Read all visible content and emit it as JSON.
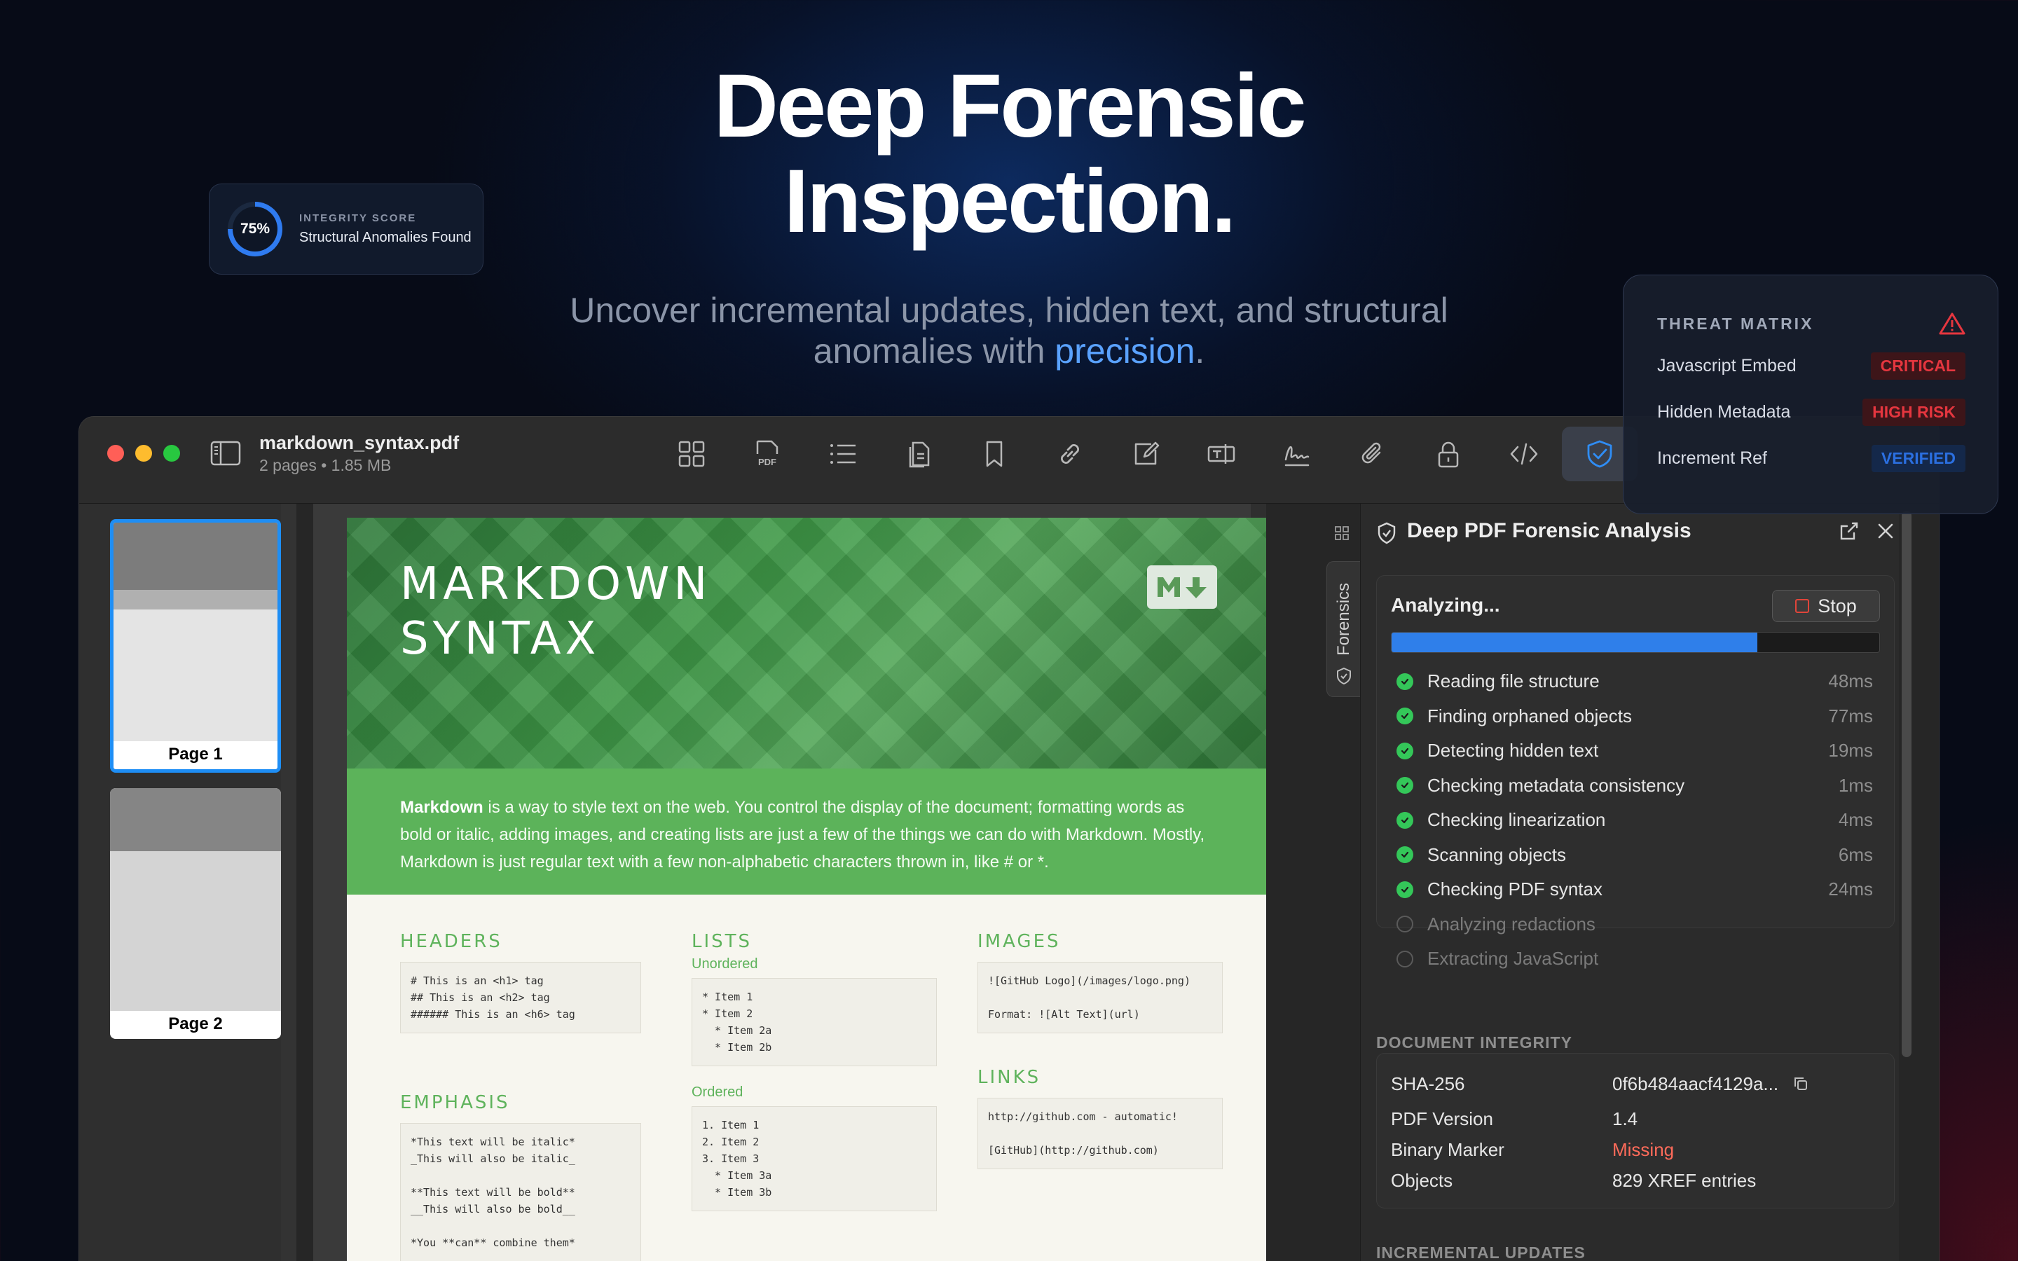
{
  "hero": {
    "title_line1": "Deep Forensic",
    "title_line2": "Inspection.",
    "subtitle_part1": "Uncover incremental updates, hidden text, and structural",
    "subtitle_part2": "anomalies with ",
    "subtitle_accent": "precision",
    "subtitle_end": "."
  },
  "integrity_card": {
    "score": "75%",
    "score_fraction": 0.75,
    "label": "INTEGRITY SCORE",
    "title": "Structural Anomalies Found"
  },
  "threat_matrix": {
    "title": "THREAT MATRIX",
    "rows": [
      {
        "name": "Javascript Embed",
        "badge": "CRITICAL"
      },
      {
        "name": "Hidden Metadata",
        "badge": "HIGH RISK"
      },
      {
        "name": "Increment Ref",
        "badge": "VERIFIED"
      }
    ]
  },
  "window": {
    "file_name": "markdown_syntax.pdf",
    "file_meta": "2 pages • 1.85 MB",
    "toolbar": [
      {
        "icon": "grid-icon"
      },
      {
        "icon": "pdf-icon",
        "text": "PDF"
      },
      {
        "icon": "list-icon"
      },
      {
        "icon": "pages-icon"
      },
      {
        "icon": "bookmark-icon"
      },
      {
        "icon": "link-icon"
      },
      {
        "icon": "edit-icon"
      },
      {
        "icon": "text-field-icon"
      },
      {
        "icon": "signature-icon"
      },
      {
        "icon": "paperclip-icon"
      },
      {
        "icon": "lock-icon"
      },
      {
        "icon": "code-icon"
      },
      {
        "icon": "shield-check-icon"
      }
    ]
  },
  "thumbnails": [
    {
      "label": "Page 1"
    },
    {
      "label": "Page 2"
    }
  ],
  "document": {
    "banner_line1": "MARKDOWN",
    "banner_line2": "SYNTAX",
    "intro_bold": "Markdown",
    "intro_rest": " is a way to style text on the web. You control the display of the document; formatting words as bold or italic, adding images, and creating lists are just a few of the things we can do with Markdown. Mostly, Markdown is just regular text with a few non-alphabetic characters thrown in, like # or *.",
    "headers": {
      "title": "HEADERS",
      "code": "# This is an <h1> tag\n## This is an <h2> tag\n###### This is an <h6> tag"
    },
    "emphasis": {
      "title": "EMPHASIS",
      "code": "*This text will be italic*\n_This will also be italic_\n\n**This text will be bold**\n__This will also be bold__\n\n*You **can** combine them*"
    },
    "lists": {
      "title": "LISTS",
      "unordered_label": "Unordered",
      "unordered_code": "* Item 1\n* Item 2\n  * Item 2a\n  * Item 2b",
      "ordered_label": "Ordered",
      "ordered_code": "1. Item 1\n2. Item 2\n3. Item 3\n  * Item 3a\n  * Item 3b"
    },
    "images": {
      "title": "IMAGES",
      "code": "![GitHub Logo](/images/logo.png)\n\nFormat: ![Alt Text](url)"
    },
    "links": {
      "title": "LINKS",
      "code": "http://github.com - automatic!\n\n[GitHub](http://github.com)"
    }
  },
  "panel": {
    "rail_tab": "Forensics",
    "title": "Deep PDF Forensic Analysis",
    "status": "Analyzing...",
    "stop_label": "Stop",
    "progress": 0.75,
    "steps": [
      {
        "label": "Reading file structure",
        "ms": "48ms",
        "done": true
      },
      {
        "label": "Finding orphaned objects",
        "ms": "77ms",
        "done": true
      },
      {
        "label": "Detecting hidden text",
        "ms": "19ms",
        "done": true
      },
      {
        "label": "Checking metadata consistency",
        "ms": "1ms",
        "done": true
      },
      {
        "label": "Checking linearization",
        "ms": "4ms",
        "done": true
      },
      {
        "label": "Scanning objects",
        "ms": "6ms",
        "done": true
      },
      {
        "label": "Checking PDF syntax",
        "ms": "24ms",
        "done": true
      },
      {
        "label": "Analyzing redactions",
        "ms": "",
        "done": false
      },
      {
        "label": "Extracting JavaScript",
        "ms": "",
        "done": false
      }
    ],
    "integrity_title": "DOCUMENT INTEGRITY",
    "integrity": [
      {
        "key": "SHA-256",
        "value": "0f6b484aacf4129a..."
      },
      {
        "key": "PDF Version",
        "value": "1.4"
      },
      {
        "key": "Binary Marker",
        "value": "Missing"
      },
      {
        "key": "Objects",
        "value": "829 XREF entries"
      }
    ],
    "incremental_title": "INCREMENTAL UPDATES"
  },
  "colors": {
    "accent": "#2f7bf0",
    "critical": "#e5363f",
    "verified": "#2b6fe0",
    "success": "#34c759"
  }
}
